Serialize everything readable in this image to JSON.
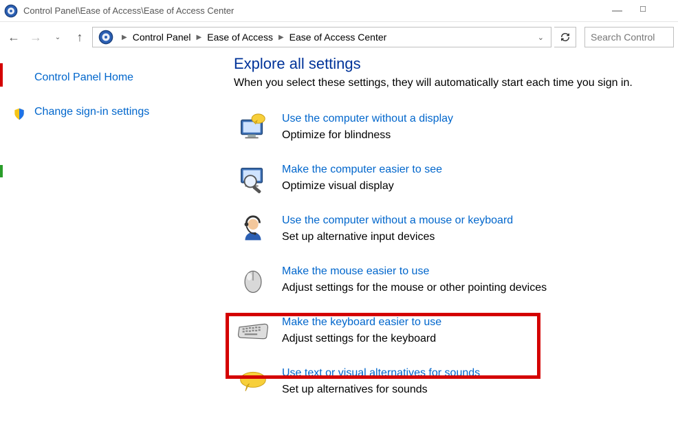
{
  "titlebar": {
    "title": "Control Panel\\Ease of Access\\Ease of Access Center"
  },
  "breadcrumbs": {
    "crumb1": "Control Panel",
    "crumb2": "Ease of Access",
    "crumb3": "Ease of Access Center"
  },
  "search": {
    "placeholder": "Search Control"
  },
  "sidebar": {
    "home": "Control Panel Home",
    "signin": "Change sign-in settings"
  },
  "main": {
    "heading": "Explore all settings",
    "sub": "When you select these settings, they will automatically start each time you sign in."
  },
  "options": [
    {
      "title": "Use the computer without a display",
      "desc": "Optimize for blindness"
    },
    {
      "title": "Make the computer easier to see",
      "desc": "Optimize visual display"
    },
    {
      "title": "Use the computer without a mouse or keyboard",
      "desc": "Set up alternative input devices"
    },
    {
      "title": "Make the mouse easier to use",
      "desc": "Adjust settings for the mouse or other pointing devices"
    },
    {
      "title": "Make the keyboard easier to use",
      "desc": "Adjust settings for the keyboard"
    },
    {
      "title": "Use text or visual alternatives for sounds",
      "desc": "Set up alternatives for sounds"
    }
  ]
}
